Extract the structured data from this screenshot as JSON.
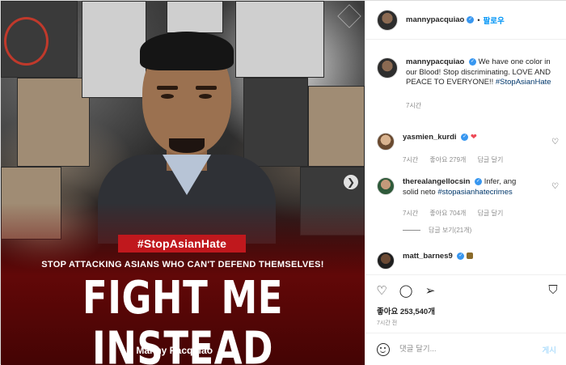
{
  "post": {
    "hashtag_banner": "#StopAsianHate",
    "subheading": "STOP ATTACKING ASIANS WHO CAN'T DEFEND THEMSELVES!",
    "headline": "FIGHT ME INSTEAD",
    "attribution": "- Manny Pacquiao",
    "next_glyph": "❯"
  },
  "header": {
    "username": "mannypacquiao",
    "follow_label": "팔로우",
    "dot": "•"
  },
  "caption": {
    "username": "mannypacquiao",
    "text": "We have one color in our Blood! Stop discriminating. LOVE AND PEACE TO EVERYONE!!",
    "hashtag": "#StopAsianHate",
    "time": "7시간"
  },
  "comments": [
    {
      "username": "yasmien_kurdi",
      "text": "❤",
      "time": "7시간",
      "likes": "좋아요 279개",
      "reply": "답글 달기"
    },
    {
      "username": "therealangellocsin",
      "text": "Infer, ang solid neto",
      "hashtag": "#stopasianhatecrimes",
      "time": "7시간",
      "likes": "좋아요 704개",
      "reply": "답글 달기",
      "view_replies": "답글 보기(21개)"
    },
    {
      "username": "matt_barnes9"
    }
  ],
  "actions": {
    "likes": "좋아요 253,540개",
    "posted_time": "7시간 전"
  },
  "comment_box": {
    "placeholder": "댓글 달기...",
    "post_label": "게시"
  },
  "colors": {
    "accent": "#0095f6",
    "banner_red": "#c0181d",
    "heart_red": "#ed4956"
  }
}
